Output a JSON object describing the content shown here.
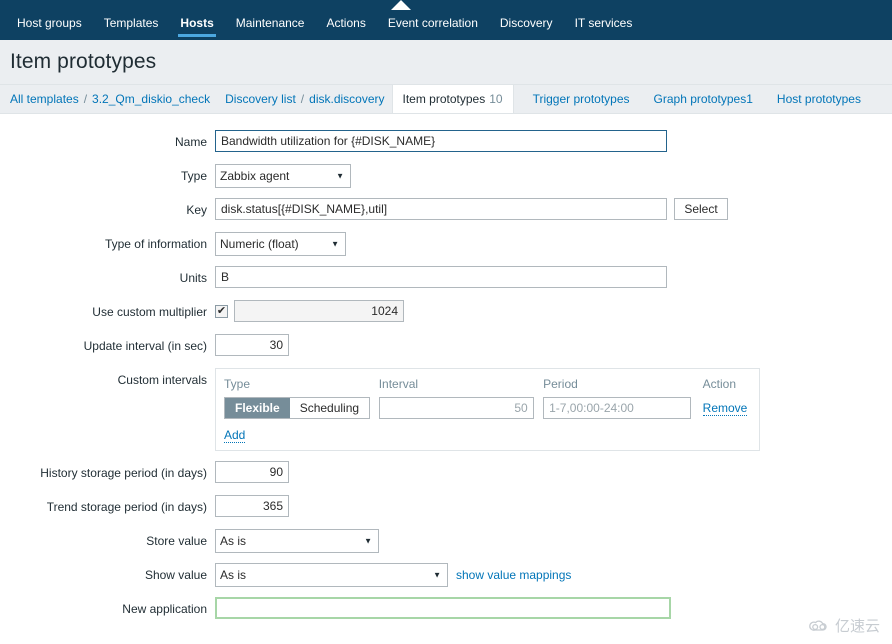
{
  "topnav": {
    "items": [
      {
        "label": "Host groups",
        "active": false
      },
      {
        "label": "Templates",
        "active": false
      },
      {
        "label": "Hosts",
        "active": true
      },
      {
        "label": "Maintenance",
        "active": false
      },
      {
        "label": "Actions",
        "active": false
      },
      {
        "label": "Event correlation",
        "active": false
      },
      {
        "label": "Discovery",
        "active": false
      },
      {
        "label": "IT services",
        "active": false
      }
    ],
    "bg_color": "#0e4162",
    "active_underline_color": "#4ca8e0"
  },
  "header": {
    "title": "Item prototypes"
  },
  "breadcrumb": {
    "all_templates": "All templates",
    "sep1": "/",
    "template_name": "3.2_Qm_diskio_check",
    "discovery_list": "Discovery list",
    "sep2": "/",
    "discovery_rule": "disk.discovery",
    "tabs": [
      {
        "label": "Item prototypes",
        "count": "10",
        "active": true
      },
      {
        "label": "Trigger prototypes",
        "count": "",
        "active": false
      },
      {
        "label": "Graph prototypes",
        "count": "1",
        "active": false
      },
      {
        "label": "Host prototypes",
        "count": "",
        "active": false
      }
    ]
  },
  "form": {
    "name": {
      "label": "Name",
      "value": "Bandwidth utilization for {#DISK_NAME}",
      "focused": true
    },
    "type": {
      "label": "Type",
      "value": "Zabbix agent",
      "options": [
        "Zabbix agent"
      ]
    },
    "key": {
      "label": "Key",
      "value": "disk.status[{#DISK_NAME},util]",
      "select_button": "Select"
    },
    "type_of_information": {
      "label": "Type of information",
      "value": "Numeric (float)",
      "options": [
        "Numeric (float)"
      ]
    },
    "units": {
      "label": "Units",
      "value": "B"
    },
    "custom_multiplier": {
      "label": "Use custom multiplier",
      "checked": true,
      "checkmark": "✔",
      "value": "1024"
    },
    "update_interval": {
      "label": "Update interval (in sec)",
      "value": "30"
    },
    "custom_intervals": {
      "label": "Custom intervals",
      "columns": {
        "type": "Type",
        "interval": "Interval",
        "period": "Period",
        "action": "Action"
      },
      "rows": [
        {
          "type_options": [
            "Flexible",
            "Scheduling"
          ],
          "type_selected": "Flexible",
          "interval_value": "",
          "interval_placeholder": "50",
          "period_value": "",
          "period_placeholder": "1-7,00:00-24:00",
          "action": "Remove"
        }
      ],
      "add_label": "Add"
    },
    "history_storage": {
      "label": "History storage period (in days)",
      "value": "90"
    },
    "trend_storage": {
      "label": "Trend storage period (in days)",
      "value": "365"
    },
    "store_value": {
      "label": "Store value",
      "value": "As is",
      "options": [
        "As is"
      ]
    },
    "show_value": {
      "label": "Show value",
      "value": "As is",
      "options": [
        "As is"
      ],
      "link": "show value mappings"
    },
    "new_application": {
      "label": "New application",
      "value": "",
      "highlight_color": "#a7d6a7"
    }
  },
  "watermark": {
    "text": "亿速云",
    "icon": "cloud-icon"
  }
}
